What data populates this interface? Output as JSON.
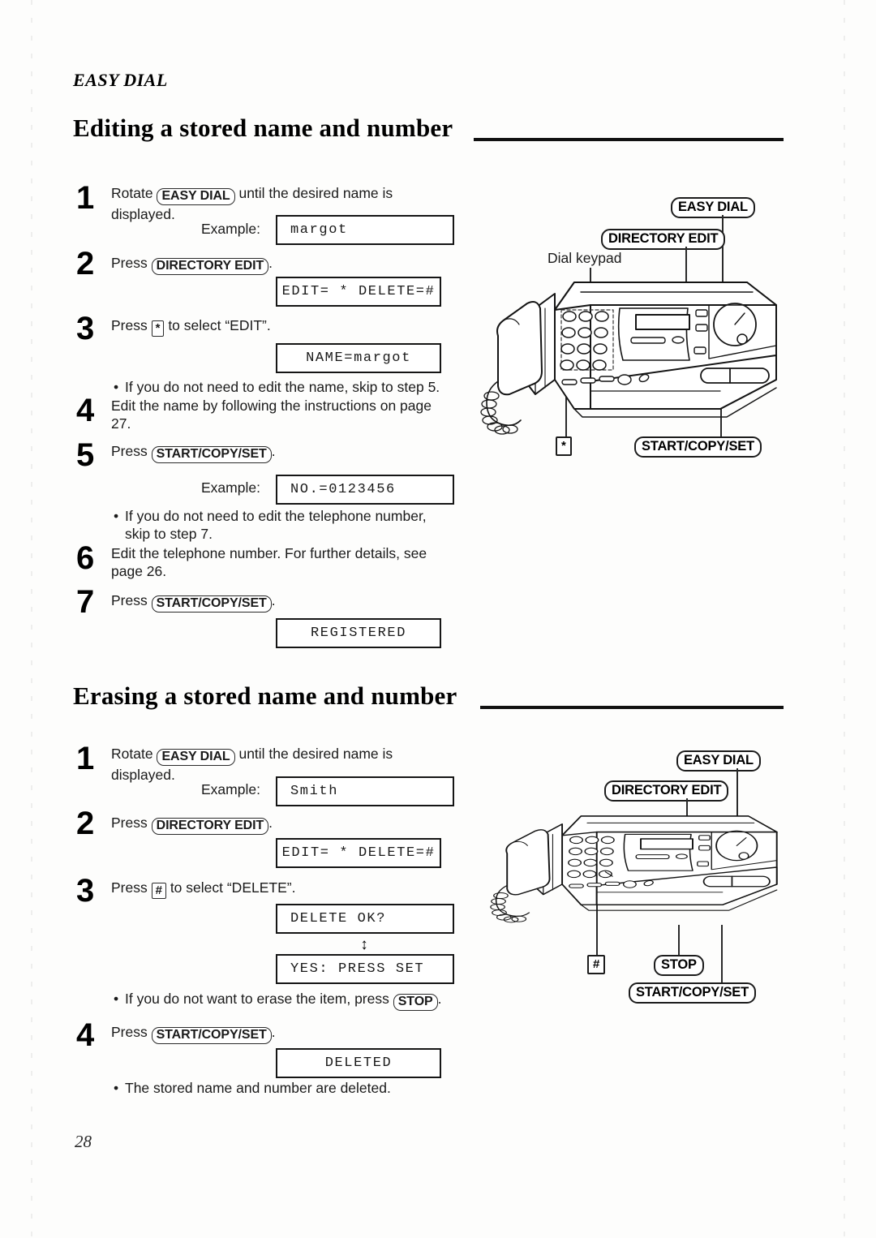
{
  "document": {
    "running_head": "EASY DIAL",
    "page_number": "28"
  },
  "sections": [
    {
      "id": "editing",
      "heading": "Editing a stored name and number",
      "steps": [
        {
          "number": "1",
          "text_before": "Rotate ",
          "key": "EASY DIAL",
          "text_after": " until the desired name is displayed."
        },
        {
          "number": "2",
          "text_before": "Press ",
          "key": "DIRECTORY EDIT",
          "text_after": "."
        },
        {
          "number": "3",
          "text_before": "Press ",
          "key": "*",
          "text_after": " to select “EDIT”."
        },
        {
          "number": "4",
          "text": "Edit the name by following the instructions on page 27."
        },
        {
          "number": "5",
          "text_before": "Press ",
          "key": "START/COPY/SET",
          "text_after": "."
        },
        {
          "number": "6",
          "text": "Edit the telephone number. For further details, see page 26."
        },
        {
          "number": "7",
          "text_before": "Press ",
          "key": "START/COPY/SET",
          "text_after": "."
        }
      ],
      "example_label_1": "Example:",
      "example_label_2": "Example:",
      "displays": [
        {
          "id": "d1",
          "text": "margot",
          "align": "left"
        },
        {
          "id": "d2",
          "text": "EDIT= *  DELETE=#",
          "align": "center"
        },
        {
          "id": "d3",
          "text": "NAME=margot",
          "align": "center"
        },
        {
          "id": "d4",
          "text": "NO.=0123456",
          "align": "left"
        },
        {
          "id": "d5",
          "text": "REGISTERED",
          "align": "center"
        }
      ],
      "notes": [
        "If you do not need to edit the name, skip to step 5.",
        "If you do not need to edit the telephone number, skip to step 7."
      ],
      "figure": {
        "callouts": [
          "EASY DIAL",
          "DIRECTORY EDIT",
          "START/COPY/SET"
        ],
        "plain_label": "Dial keypad",
        "square_callout": "*"
      }
    },
    {
      "id": "erasing",
      "heading": "Erasing a stored name and number",
      "steps": [
        {
          "number": "1",
          "text_before": "Rotate ",
          "key": "EASY DIAL",
          "text_after": " until the desired name is displayed."
        },
        {
          "number": "2",
          "text_before": "Press ",
          "key": "DIRECTORY EDIT",
          "text_after": "."
        },
        {
          "number": "3",
          "text_before": "Press ",
          "key": "#",
          "text_after": " to select “DELETE”."
        },
        {
          "number": "4",
          "text_before": "Press ",
          "key": "START/COPY/SET",
          "text_after": "."
        }
      ],
      "example_label_1": "Example:",
      "displays": [
        {
          "id": "e1",
          "text": "Smith",
          "align": "left"
        },
        {
          "id": "e2",
          "text": "EDIT= *  DELETE=#",
          "align": "center"
        },
        {
          "id": "e3",
          "text": "DELETE OK?",
          "align": "left"
        },
        {
          "id": "e4",
          "text": "YES: PRESS SET",
          "align": "left"
        },
        {
          "id": "e5",
          "text": "DELETED",
          "align": "center"
        }
      ],
      "arrow_symbol": "↕",
      "notes": [
        {
          "before": "If you do not want to erase the item, press ",
          "key": "STOP",
          "after": "."
        },
        {
          "text": "The stored name and number are deleted."
        }
      ],
      "figure": {
        "callouts": [
          "EASY DIAL",
          "DIRECTORY EDIT",
          "STOP",
          "START/COPY/SET"
        ],
        "square_callout": "#"
      }
    }
  ]
}
